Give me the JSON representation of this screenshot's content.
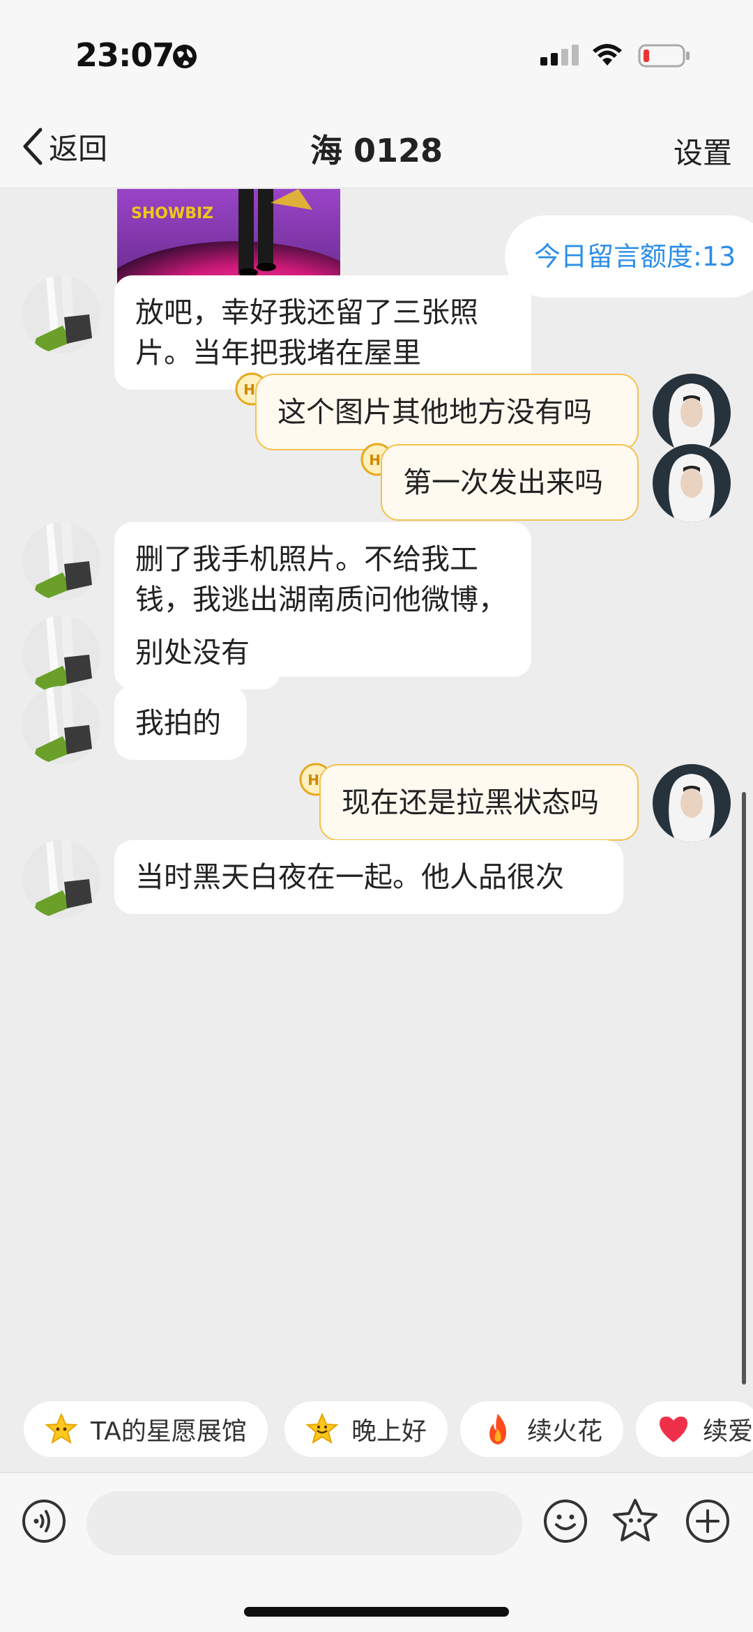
{
  "status_bar": {
    "time": "23:07"
  },
  "nav": {
    "back_label": "返回",
    "title": "海 0128",
    "settings_label": "设置"
  },
  "quota": {
    "label": "今日留言额度:13"
  },
  "messages": [
    {
      "side": "left",
      "text": "放吧，幸好我还留了三张照片。当年把我堵在屋里"
    },
    {
      "side": "right",
      "text": "这个图片其他地方没有吗"
    },
    {
      "side": "right",
      "text": "第一次发出来吗"
    },
    {
      "side": "left",
      "text": "删了我手机照片。不给我工钱，我逃出湖南质问他微博，把我拉黑"
    },
    {
      "side": "left",
      "text": "别处没有"
    },
    {
      "side": "left",
      "text": "我拍的"
    },
    {
      "side": "right",
      "text": "现在还是拉黑状态吗"
    },
    {
      "side": "left",
      "text": "当时黑天白夜在一起。他人品很次"
    }
  ],
  "hi_badge": "Hi",
  "quick_replies": [
    {
      "label": "TA的星愿展馆",
      "icon": "star-face-icon"
    },
    {
      "label": "晚上好",
      "icon": "star-smile-icon"
    },
    {
      "label": "续火花",
      "icon": "flame-icon"
    },
    {
      "label": "续爱",
      "icon": "heart-icon"
    }
  ],
  "input": {
    "placeholder": ""
  },
  "colors": {
    "accent_blue": "#2c8ee8",
    "my_bubble_bg": "#fffaf0",
    "my_bubble_border": "#f2c14e",
    "chat_bg": "#ededed"
  }
}
